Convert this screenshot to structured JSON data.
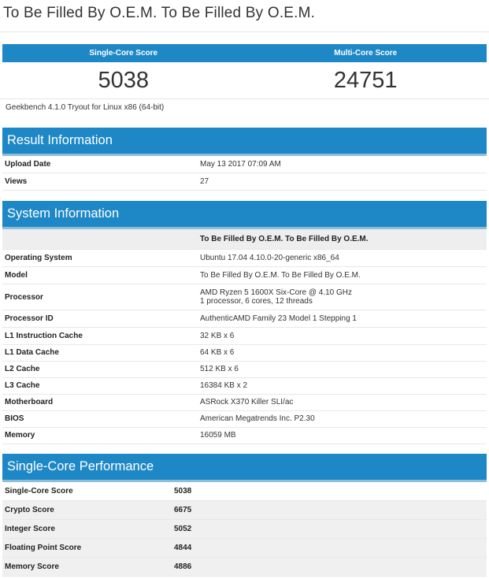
{
  "page": {
    "title": "To Be Filled By O.E.M. To Be Filled By O.E.M."
  },
  "scores": {
    "single_label": "Single-Core Score",
    "multi_label": "Multi-Core Score",
    "single_value": "5038",
    "multi_value": "24751",
    "caption": "Geekbench 4.1.0 Tryout for Linux x86 (64-bit)"
  },
  "result_info": {
    "heading": "Result Information",
    "rows": [
      {
        "key": "Upload Date",
        "value": "May 13 2017 07:09 AM"
      },
      {
        "key": "Views",
        "value": "27"
      }
    ]
  },
  "system_info": {
    "heading": "System Information",
    "column_header": "To Be Filled By O.E.M. To Be Filled By O.E.M.",
    "rows": [
      {
        "key": "Operating System",
        "value": "Ubuntu 17.04 4.10.0-20-generic x86_64"
      },
      {
        "key": "Model",
        "value": "To Be Filled By O.E.M. To Be Filled By O.E.M."
      },
      {
        "key": "Processor",
        "value": "AMD Ryzen 5 1600X Six-Core @ 4.10 GHz",
        "value2": "1 processor, 6 cores, 12 threads"
      },
      {
        "key": "Processor ID",
        "value": "AuthenticAMD Family 23 Model 1 Stepping 1"
      },
      {
        "key": "L1 Instruction Cache",
        "value": "32 KB x 6"
      },
      {
        "key": "L1 Data Cache",
        "value": "64 KB x 6"
      },
      {
        "key": "L2 Cache",
        "value": "512 KB x 6"
      },
      {
        "key": "L3 Cache",
        "value": "16384 KB x 2"
      },
      {
        "key": "Motherboard",
        "value": "ASRock X370 Killer SLI/ac"
      },
      {
        "key": "BIOS",
        "value": "American Megatrends Inc. P2.30"
      },
      {
        "key": "Memory",
        "value": "16059 MB"
      }
    ]
  },
  "single_core": {
    "heading": "Single-Core Performance",
    "rows": [
      {
        "key": "Single-Core Score",
        "value": "5038"
      },
      {
        "key": "Crypto Score",
        "value": "6675"
      },
      {
        "key": "Integer Score",
        "value": "5052"
      },
      {
        "key": "Floating Point Score",
        "value": "4844"
      },
      {
        "key": "Memory Score",
        "value": "4886"
      }
    ]
  }
}
